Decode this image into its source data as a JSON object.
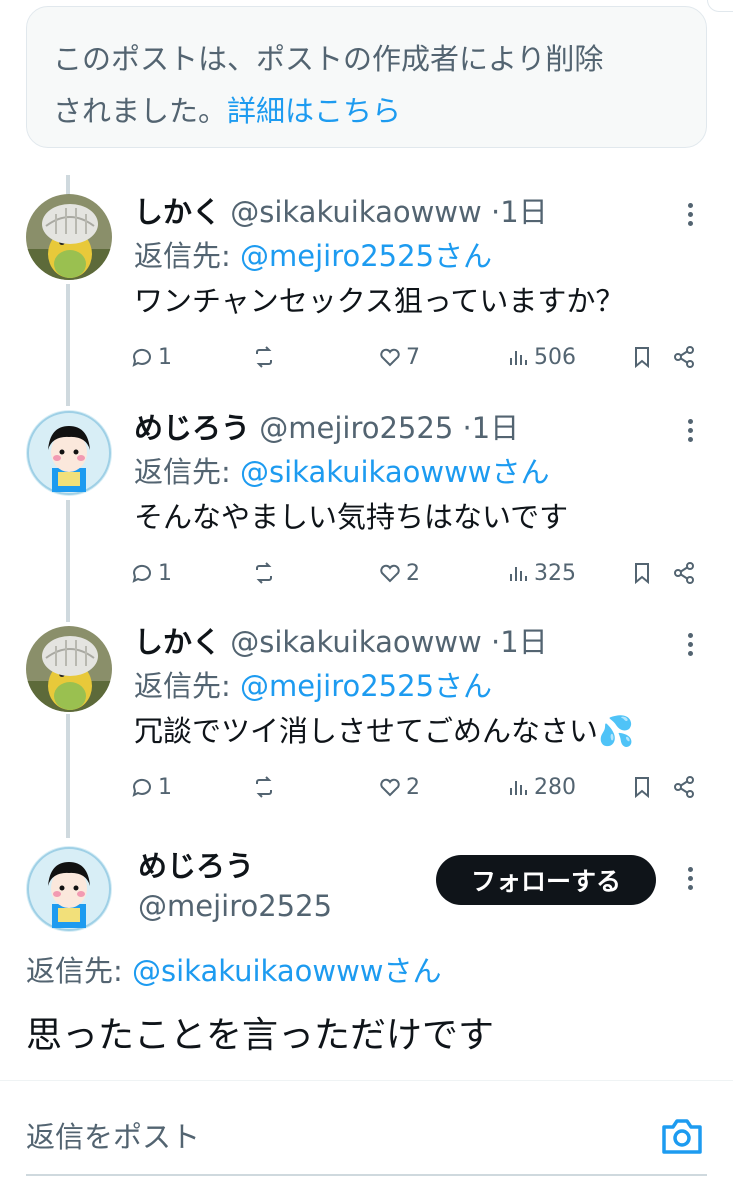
{
  "deleted_notice": {
    "line1": "このポストは、ポストの作成者により削除",
    "line2": "されました。",
    "link": "詳細はこちら"
  },
  "tweets": [
    {
      "name": "しかく",
      "handle": "@sikakuikaowww",
      "dot": "·",
      "time": "1日",
      "reply_prefix": "返信先: ",
      "reply_mention": "@mejiro2525さん",
      "text": "ワンチャンセックス狙っていますか？",
      "replies": "1",
      "retweets": "",
      "likes": "7",
      "views": "506"
    },
    {
      "name": "めじろう",
      "handle": "@mejiro2525",
      "dot": "·",
      "time": "1日",
      "reply_prefix": "返信先: ",
      "reply_mention": "@sikakuikaowwwさん",
      "text": "そんなやましい気持ちはないです",
      "replies": "1",
      "retweets": "",
      "likes": "2",
      "views": "325"
    },
    {
      "name": "しかく",
      "handle": "@sikakuikaowww",
      "dot": "·",
      "time": "1日",
      "reply_prefix": "返信先: ",
      "reply_mention": "@mejiro2525さん",
      "text": "冗談でツイ消しさせてごめんなさい💦",
      "replies": "1",
      "retweets": "",
      "likes": "2",
      "views": "280"
    }
  ],
  "main_post": {
    "name": "めじろう",
    "handle": "@mejiro2525",
    "follow_label": "フォローする",
    "reply_prefix": "返信先: ",
    "reply_mention": "@sikakuikaowwwさん",
    "text": "思ったことを言っただけです"
  },
  "reply_box": {
    "placeholder": "返信をポスト"
  },
  "colors": {
    "accent": "#1d9bf0",
    "text": "#0f1419",
    "secondary": "#536471",
    "follow_bg": "#0f1419"
  },
  "icons": [
    "reply-icon",
    "retweet-icon",
    "like-icon",
    "views-icon",
    "bookmark-icon",
    "share-icon",
    "more-icon",
    "camera-icon"
  ]
}
